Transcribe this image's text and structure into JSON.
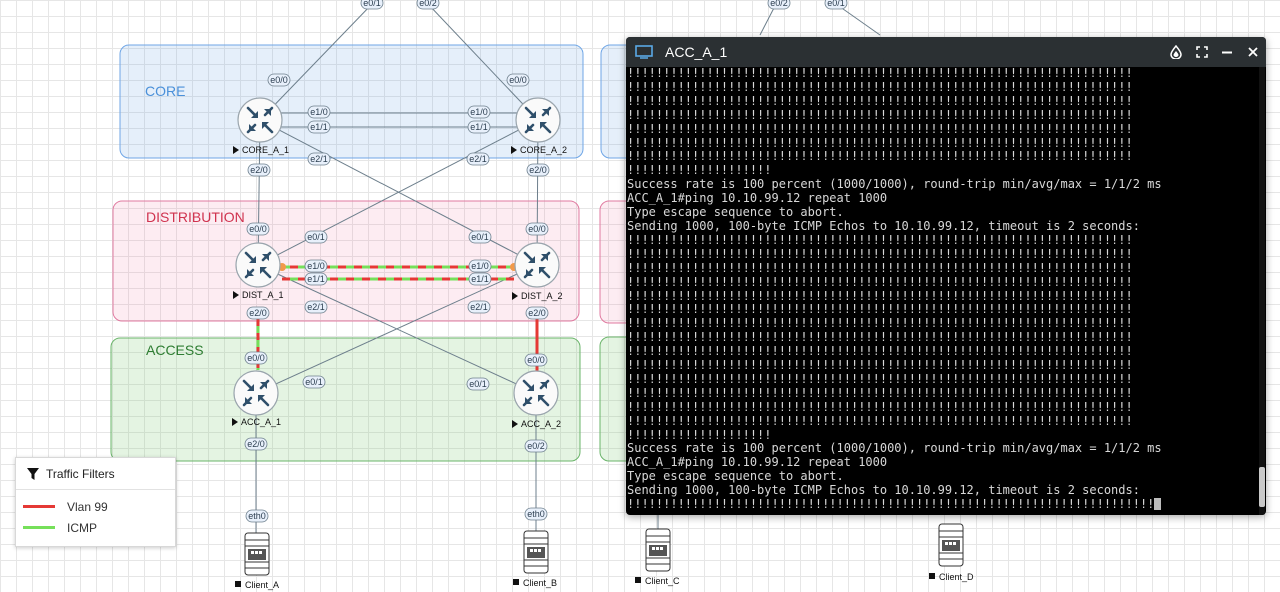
{
  "zones": {
    "core": {
      "label": "CORE",
      "color": "#4a90d9"
    },
    "distribution": {
      "label": "DISTRIBUTION",
      "color": "#d0334f"
    },
    "access": {
      "label": "ACCESS",
      "color": "#2e7d32"
    }
  },
  "nodes": {
    "core_a_1": "CORE_A_1",
    "core_a_2": "CORE_A_2",
    "dist_a_1": "DIST_A_1",
    "dist_a_2": "DIST_A_2",
    "acc_a_1": "ACC_A_1",
    "acc_a_2": "ACC_A_2",
    "client_a": "Client_A",
    "client_b": "Client_B",
    "client_c": "Client_C",
    "client_d": "Client_D"
  },
  "ports": {
    "top_e0_1": "e0/1",
    "top_e0_2": "e0/2",
    "top_right_e0_2": "e0/2",
    "top_right_e0_1": "e0/1",
    "core1_e0_0": "e0/0",
    "core2_e0_0": "e0/0",
    "core1_e1_0": "e1/0",
    "core1_e1_1": "e1/1",
    "core2_e1_0": "e1/0",
    "core2_e1_1": "e1/1",
    "core1_e2_1": "e2/1",
    "core2_e2_1": "e2/1",
    "core1_e2_0": "e2/0",
    "core2_e2_0": "e2/0",
    "dist1_e0_0": "e0/0",
    "dist2_e0_0": "e0/0",
    "dist1_e0_1": "e0/1",
    "dist2_e0_1": "e0/1",
    "dist1_e1_0": "e1/0",
    "dist1_e1_1": "e1/1",
    "dist2_e1_0": "e1/0",
    "dist2_e1_1": "e1/1",
    "dist1_e2_1": "e2/1",
    "dist2_e2_1": "e2/1",
    "dist1_e2_0": "e2/0",
    "dist2_e2_0": "e2/0",
    "acc1_e0_0": "e0/0",
    "acc2_e0_0": "e0/0",
    "acc1_e0_1": "e0/1",
    "acc2_e0_1": "e0/1",
    "acc1_e2_0": "e2/0",
    "acc2_e0_2": "e0/2",
    "clienta_eth0": "eth0",
    "clientb_eth0": "eth0"
  },
  "terminal": {
    "title": "ACC_A_1",
    "lines": [
      "!!!!!!!!!!!!!!!!!!!!!!!!!!!!!!!!!!!!!!!!!!!!!!!!!!!!!!!!!!!!!!!!!!!!!!",
      "!!!!!!!!!!!!!!!!!!!!!!!!!!!!!!!!!!!!!!!!!!!!!!!!!!!!!!!!!!!!!!!!!!!!!!",
      "!!!!!!!!!!!!!!!!!!!!!!!!!!!!!!!!!!!!!!!!!!!!!!!!!!!!!!!!!!!!!!!!!!!!!!",
      "!!!!!!!!!!!!!!!!!!!!!!!!!!!!!!!!!!!!!!!!!!!!!!!!!!!!!!!!!!!!!!!!!!!!!!",
      "!!!!!!!!!!!!!!!!!!!!!!!!!!!!!!!!!!!!!!!!!!!!!!!!!!!!!!!!!!!!!!!!!!!!!!",
      "!!!!!!!!!!!!!!!!!!!!!!!!!!!!!!!!!!!!!!!!!!!!!!!!!!!!!!!!!!!!!!!!!!!!!!",
      "!!!!!!!!!!!!!!!!!!!!!!!!!!!!!!!!!!!!!!!!!!!!!!!!!!!!!!!!!!!!!!!!!!!!!!",
      "!!!!!!!!!!!!!!!!!!!!",
      "Success rate is 100 percent (1000/1000), round-trip min/avg/max = 1/1/2 ms",
      "ACC_A_1#ping 10.10.99.12 repeat 1000",
      "Type escape sequence to abort.",
      "Sending 1000, 100-byte ICMP Echos to 10.10.99.12, timeout is 2 seconds:",
      "!!!!!!!!!!!!!!!!!!!!!!!!!!!!!!!!!!!!!!!!!!!!!!!!!!!!!!!!!!!!!!!!!!!!!!",
      "!!!!!!!!!!!!!!!!!!!!!!!!!!!!!!!!!!!!!!!!!!!!!!!!!!!!!!!!!!!!!!!!!!!!!!",
      "!!!!!!!!!!!!!!!!!!!!!!!!!!!!!!!!!!!!!!!!!!!!!!!!!!!!!!!!!!!!!!!!!!!!!!",
      "!!!!!!!!!!!!!!!!!!!!!!!!!!!!!!!!!!!!!!!!!!!!!!!!!!!!!!!!!!!!!!!!!!!!!!",
      "!!!!!!!!!!!!!!!!!!!!!!!!!!!!!!!!!!!!!!!!!!!!!!!!!!!!!!!!!!!!!!!!!!!!!!",
      "!!!!!!!!!!!!!!!!!!!!!!!!!!!!!!!!!!!!!!!!!!!!!!!!!!!!!!!!!!!!!!!!!!!!!!",
      "!!!!!!!!!!!!!!!!!!!!!!!!!!!!!!!!!!!!!!!!!!!!!!!!!!!!!!!!!!!!!!!!!!!!!!",
      "!!!!!!!!!!!!!!!!!!!!!!!!!!!!!!!!!!!!!!!!!!!!!!!!!!!!!!!!!!!!!!!!!!!!!!",
      "!!!!!!!!!!!!!!!!!!!!!!!!!!!!!!!!!!!!!!!!!!!!!!!!!!!!!!!!!!!!!!!!!!!!!!",
      "!!!!!!!!!!!!!!!!!!!!!!!!!!!!!!!!!!!!!!!!!!!!!!!!!!!!!!!!!!!!!!!!!!!!!!",
      "!!!!!!!!!!!!!!!!!!!!!!!!!!!!!!!!!!!!!!!!!!!!!!!!!!!!!!!!!!!!!!!!!!!!!!",
      "!!!!!!!!!!!!!!!!!!!!!!!!!!!!!!!!!!!!!!!!!!!!!!!!!!!!!!!!!!!!!!!!!!!!!!",
      "!!!!!!!!!!!!!!!!!!!!!!!!!!!!!!!!!!!!!!!!!!!!!!!!!!!!!!!!!!!!!!!!!!!!!!",
      "!!!!!!!!!!!!!!!!!!!!!!!!!!!!!!!!!!!!!!!!!!!!!!!!!!!!!!!!!!!!!!!!!!!!!!",
      "!!!!!!!!!!!!!!!!!!!!",
      "Success rate is 100 percent (1000/1000), round-trip min/avg/max = 1/1/2 ms",
      "ACC_A_1#ping 10.10.99.12 repeat 1000",
      "Type escape sequence to abort.",
      "Sending 1000, 100-byte ICMP Echos to 10.10.99.12, timeout is 2 seconds:",
      "!!!!!!!!!!!!!!!!!!!!!!!!!!!!!!!!!!!!!!!!!!!!!!!!!!!!!!!!!!!!!!!!!!!!!!!!!"
    ],
    "icons": {
      "monitor": "monitor-icon",
      "theme": "drop-icon",
      "fullscreen": "fullscreen-icon",
      "minimize": "minimize-icon",
      "close": "close-icon"
    }
  },
  "filters": {
    "title": "Traffic Filters",
    "items": [
      {
        "label": "Vlan 99",
        "color": "#e53935"
      },
      {
        "label": "ICMP",
        "color": "#76e05a"
      }
    ]
  }
}
